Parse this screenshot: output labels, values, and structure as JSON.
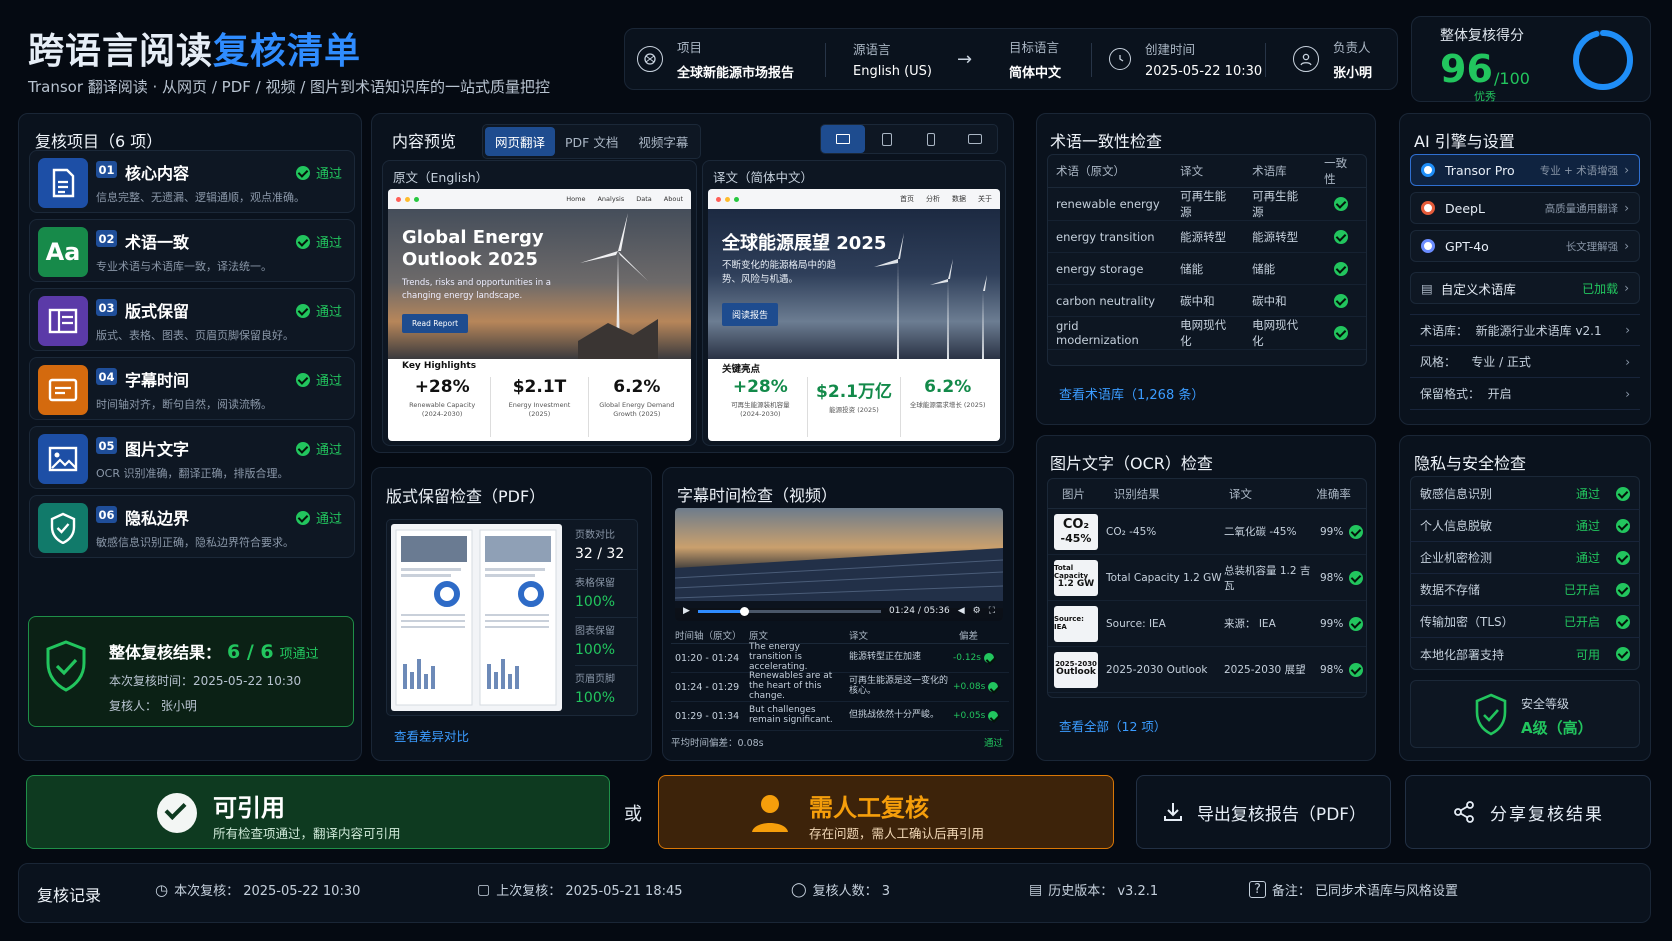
{
  "header": {
    "title_a": "跨语言阅读",
    "title_b": "复核清单",
    "subtitle": "Transor 翻译阅读 · 从网页 / PDF / 视频 / 图片到术语知识库的一站式质量把控",
    "project_label": "项目",
    "project_value": "全球新能源市场报告",
    "src_label": "源语言",
    "src_value": "English (US)",
    "tgt_label": "目标语言",
    "tgt_value": "简体中文",
    "time_label": "创建时间",
    "time_value": "2025-05-22 10:30",
    "owner_label": "负责人",
    "owner_value": "张小明",
    "score_label": "整体复核得分",
    "score_value": "96",
    "score_total": "/100",
    "score_grade": "优秀",
    "score_percent": 96
  },
  "review": {
    "title": "复核项目（6 项）",
    "items": [
      {
        "num": "01",
        "title": "核心内容",
        "desc": "信息完整、无遗漏、逻辑通顺，观点准确。",
        "status": "通过",
        "color": "#1d4fa6"
      },
      {
        "num": "02",
        "title": "术语一致",
        "desc": "专业术语与术语库一致，译法统一。",
        "status": "通过",
        "color": "#178a4a",
        "icon_text": "Aa"
      },
      {
        "num": "03",
        "title": "版式保留",
        "desc": "版式、表格、图表、页眉页脚保留良好。",
        "status": "通过",
        "color": "#5b3aa8"
      },
      {
        "num": "04",
        "title": "字幕时间",
        "desc": "时间轴对齐，断句自然，阅读流畅。",
        "status": "通过",
        "color": "#d46a0e"
      },
      {
        "num": "05",
        "title": "图片文字",
        "desc": "OCR 识别准确，翻译正确，排版合理。",
        "status": "通过",
        "color": "#1d4fa6"
      },
      {
        "num": "06",
        "title": "隐私边界",
        "desc": "敏感信息识别正确，隐私边界符合要求。",
        "status": "通过",
        "color": "#117a6a"
      }
    ],
    "overall_label": "整体复核结果：",
    "overall_value": "6 / 6",
    "overall_suffix": "项通过",
    "overall_time": "本次复核时间：2025-05-22 10:30",
    "overall_reviewer": "复核人：  张小明"
  },
  "preview": {
    "title": "内容预览",
    "tabs": [
      "网页翻译",
      "PDF 文档",
      "视频字幕"
    ],
    "src_label": "原文（English）",
    "tgt_label": "译文（简体中文）",
    "src_nav": [
      "Home",
      "Analysis",
      "Data",
      "About"
    ],
    "tgt_nav": [
      "首页",
      "分析",
      "数据",
      "关于"
    ],
    "src_h1": "Global Energy Outlook 2025",
    "src_p": "Trends, risks and opportunities in a changing energy landscape.",
    "src_btn": "Read Report",
    "tgt_h1": "全球能源展望 2025",
    "tgt_p": "不断变化的能源格局中的趋势、风险与机遇。",
    "tgt_btn": "阅读报告",
    "src_hl": "Key Highlights",
    "tgt_hl": "关键亮点",
    "src_stats": [
      {
        "v": "+28%",
        "l": "Renewable Capacity (2024-2030)"
      },
      {
        "v": "$2.1T",
        "l": "Energy Investment (2025)"
      },
      {
        "v": "6.2%",
        "l": "Global Energy Demand Growth (2025)"
      }
    ],
    "tgt_stats": [
      {
        "v": "+28%",
        "l": "可再生能源装机容量 (2024-2030)"
      },
      {
        "v": "$2.1万亿",
        "l": "能源投资 (2025)"
      },
      {
        "v": "6.2%",
        "l": "全球能源需求增长 (2025)"
      }
    ]
  },
  "layout_check": {
    "title": "版式保留检查（PDF）",
    "stats": [
      {
        "l": "页数对比",
        "v": "32 / 32"
      },
      {
        "l": "表格保留",
        "v": "100%"
      },
      {
        "l": "图表保留",
        "v": "100%"
      },
      {
        "l": "页眉页脚",
        "v": "100%"
      }
    ],
    "link": "查看差异对比"
  },
  "subtitle_check": {
    "title": "字幕时间检查（视频）",
    "time": "01:24 / 05:36",
    "progress": 0.25,
    "headers": [
      "时间轴（原文）",
      "原文",
      "译文",
      "偏差"
    ],
    "rows": [
      {
        "t": "01:20 - 01:24",
        "src": "The energy transition is accelerating.",
        "tgt": "能源转型正在加速",
        "d": "-0.12s"
      },
      {
        "t": "01:24 - 01:29",
        "src": "Renewables are at the heart of this change.",
        "tgt": "可再生能源是这一变化的核心。",
        "d": "+0.08s"
      },
      {
        "t": "01:29 - 01:34",
        "src": "But challenges remain significant.",
        "tgt": "但挑战依然十分严峻。",
        "d": "+0.05s"
      }
    ],
    "avg": "平均时间偏差：0.08s",
    "avg_status": "通过"
  },
  "terms": {
    "title": "术语一致性检查",
    "headers": [
      "术语（原文）",
      "译文",
      "术语库",
      "一致性"
    ],
    "rows": [
      [
        "renewable energy",
        "可再生能源",
        "可再生能源"
      ],
      [
        "energy transition",
        "能源转型",
        "能源转型"
      ],
      [
        "energy storage",
        "储能",
        "储能"
      ],
      [
        "carbon neutrality",
        "碳中和",
        "碳中和"
      ],
      [
        "grid modernization",
        "电网现代化",
        "电网现代化"
      ]
    ],
    "link": "查看术语库（1,268 条）"
  },
  "ocr": {
    "title": "图片文字（OCR）检查",
    "headers": [
      "图片",
      "识别结果",
      "译文",
      "准确率"
    ],
    "rows": [
      {
        "thumb_a": "CO₂",
        "thumb_b": "-45%",
        "rec": "CO₂ -45%",
        "tr": "二氧化碳 -45%",
        "acc": "99%"
      },
      {
        "thumb_a": "Total Capacity",
        "thumb_b": "1.2 GW",
        "rec": "Total Capacity 1.2 GW",
        "tr": "总装机容量 1.2 吉瓦",
        "acc": "98%"
      },
      {
        "thumb_a": "Source: IEA",
        "thumb_b": "",
        "rec": "Source: IEA",
        "tr": "来源： IEA",
        "acc": "99%"
      },
      {
        "thumb_a": "2025-2030",
        "thumb_b": "Outlook",
        "rec": "2025-2030 Outlook",
        "tr": "2025-2030 展望",
        "acc": "98%"
      }
    ],
    "link": "查看全部（12 项）"
  },
  "ai": {
    "title": "AI 引擎与设置",
    "engines": [
      {
        "name": "Transor Pro",
        "desc": "专业 + 术语增强"
      },
      {
        "name": "DeepL",
        "desc": "高质量通用翻译"
      },
      {
        "name": "GPT-4o",
        "desc": "长文理解强"
      }
    ],
    "custom": "自定义术语库",
    "custom_status": "已加载",
    "settings": [
      "术语库：  新能源行业术语库 v2.1",
      "风格：    专业 / 正式",
      "保留格式：  开启"
    ]
  },
  "privacy": {
    "title": "隐私与安全检查",
    "rows": [
      [
        "敏感信息识别",
        "通过"
      ],
      [
        "个人信息脱敏",
        "通过"
      ],
      [
        "企业机密检测",
        "通过"
      ],
      [
        "数据不存储",
        "已开启"
      ],
      [
        "传输加密（TLS）",
        "已开启"
      ],
      [
        "本地化部署支持",
        "可用"
      ]
    ],
    "level_label": "安全等级",
    "level_value": "A级（高）"
  },
  "actions": {
    "cite_title": "可引用",
    "cite_desc": "所有检查项通过，翻译内容可引用",
    "or": "或",
    "manual_title": "需人工复核",
    "manual_desc": "存在问题，需人工确认后再引用",
    "export": "导出复核报告（PDF）",
    "share": "分享复核结果"
  },
  "footer": {
    "title": "复核记录",
    "items": [
      "本次复核：  2025-05-22 10:30",
      "上次复核：  2025-05-21 18:45",
      "复核人数：    3",
      "历史版本：  v3.2.1",
      "备注：  已同步术语库与风格设置"
    ]
  }
}
